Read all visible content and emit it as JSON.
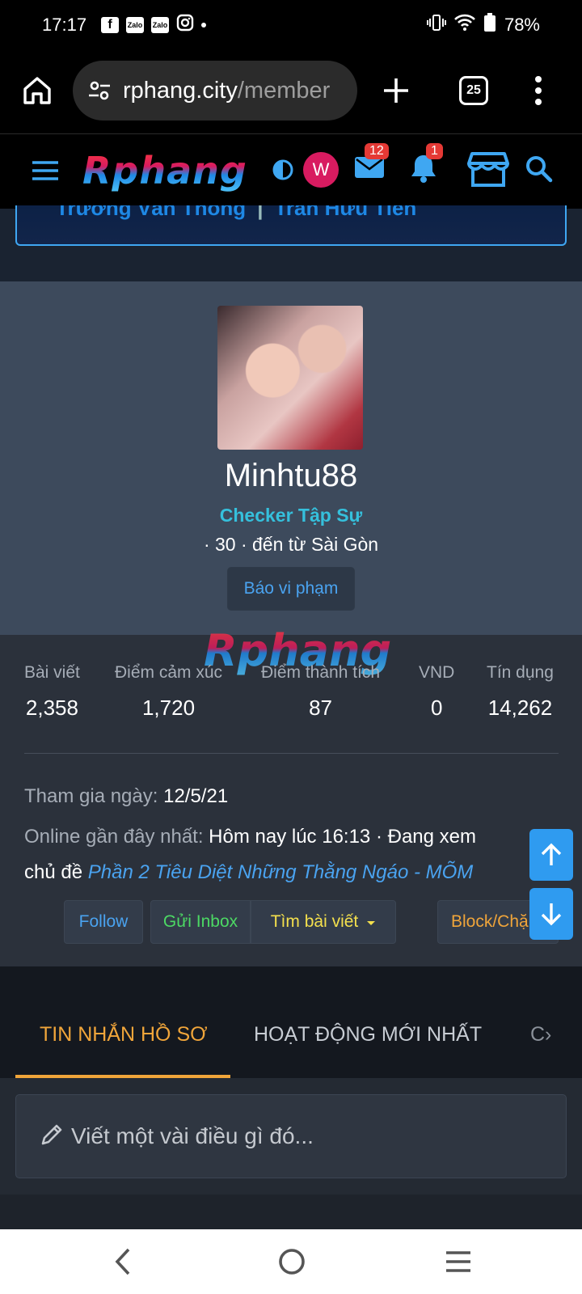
{
  "status_bar": {
    "time": "17:17",
    "app_icons": [
      "facebook-icon",
      "zalo-icon",
      "zalo-icon",
      "instagram-icon"
    ],
    "battery": "78%"
  },
  "browser": {
    "url_domain": "rphang.city",
    "url_path": "/member",
    "tab_count": "25"
  },
  "site_header": {
    "logo": "Rphang",
    "avatar_letter": "W",
    "inbox_badge": "12",
    "alerts_badge": "1"
  },
  "banner": {
    "name1": "Trương Văn Thông",
    "separator": "|",
    "name2": "Trần Hữu Tiến"
  },
  "profile": {
    "username": "Minhtu88",
    "title": "Checker Tập Sự",
    "meta": "· 30 · đến từ Sài Gòn",
    "report_label": "Báo vi phạm"
  },
  "watermark": "Rphang",
  "stats": [
    {
      "label": "Bài viết",
      "value": "2,358"
    },
    {
      "label": "Điểm cảm xúc",
      "value": "1,720"
    },
    {
      "label": "Điểm thành tích",
      "value": "87"
    },
    {
      "label": "VND",
      "value": "0"
    },
    {
      "label": "Tín dụng",
      "value": "14,262"
    }
  ],
  "info": {
    "joined_label": "Tham gia ngày:",
    "joined_value": "12/5/21",
    "online_label": "Online gần đây nhất:",
    "online_value": "Hôm nay lúc 16:13 · Đang xem",
    "viewing_prefix": "chủ đề",
    "viewing_thread": "Phần 2 Tiêu Diệt Những Thằng Ngáo - MÕM"
  },
  "actions": {
    "follow": "Follow",
    "inbox": "Gửi Inbox",
    "find_posts": "Tìm bài viết",
    "block": "Block/Chặn"
  },
  "colors": {
    "follow": "#4aa3f0",
    "inbox": "#4cd964",
    "find_posts": "#f4e04d",
    "block": "#f0a53a"
  },
  "tabs": [
    {
      "label": "TIN NHẮN HỒ SƠ",
      "active": true
    },
    {
      "label": "HOẠT ĐỘNG MỚI NHẤT",
      "active": false
    },
    {
      "label": "C›",
      "active": false
    }
  ],
  "compose": {
    "placeholder": "Viết một vài điều gì đó..."
  }
}
